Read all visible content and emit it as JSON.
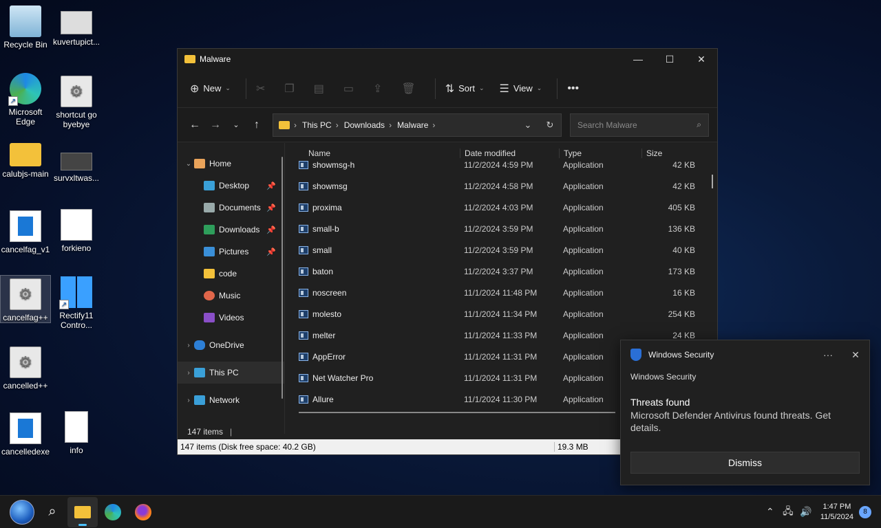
{
  "desktop": {
    "icons": [
      {
        "label": "Recycle Bin"
      },
      {
        "label": "kuvertupict..."
      },
      {
        "label": "Microsoft Edge"
      },
      {
        "label": "shortcut go byebye"
      },
      {
        "label": "calubjs-main"
      },
      {
        "label": "survxltwas..."
      },
      {
        "label": "cancelfag_v1"
      },
      {
        "label": "forkieno"
      },
      {
        "label": "cancelfag++"
      },
      {
        "label": "Rectify11 Contro..."
      },
      {
        "label": "cancelled++"
      },
      {
        "label": "cancelledexe"
      },
      {
        "label": "info"
      }
    ]
  },
  "explorer": {
    "title": "Malware",
    "toolbar": {
      "new_label": "New",
      "sort_label": "Sort",
      "view_label": "View"
    },
    "address": {
      "crumbs": [
        "This PC",
        "Downloads",
        "Malware"
      ]
    },
    "search": {
      "placeholder": "Search Malware"
    },
    "sidebar": {
      "items": [
        {
          "label": "Home"
        },
        {
          "label": "Desktop"
        },
        {
          "label": "Documents"
        },
        {
          "label": "Downloads"
        },
        {
          "label": "Pictures"
        },
        {
          "label": "code"
        },
        {
          "label": "Music"
        },
        {
          "label": "Videos"
        },
        {
          "label": "OneDrive"
        },
        {
          "label": "This PC"
        },
        {
          "label": "Network"
        }
      ]
    },
    "columns": {
      "name": "Name",
      "date": "Date modified",
      "type": "Type",
      "size": "Size"
    },
    "files": [
      {
        "name": "showmsg-h",
        "date": "11/2/2024 4:59 PM",
        "type": "Application",
        "size": "42 KB"
      },
      {
        "name": "showmsg",
        "date": "11/2/2024 4:58 PM",
        "type": "Application",
        "size": "42 KB"
      },
      {
        "name": "proxima",
        "date": "11/2/2024 4:03 PM",
        "type": "Application",
        "size": "405 KB"
      },
      {
        "name": "small-b",
        "date": "11/2/2024 3:59 PM",
        "type": "Application",
        "size": "136 KB"
      },
      {
        "name": "small",
        "date": "11/2/2024 3:59 PM",
        "type": "Application",
        "size": "40 KB"
      },
      {
        "name": "baton",
        "date": "11/2/2024 3:37 PM",
        "type": "Application",
        "size": "173 KB"
      },
      {
        "name": "noscreen",
        "date": "11/1/2024 11:48 PM",
        "type": "Application",
        "size": "16 KB"
      },
      {
        "name": "molesto",
        "date": "11/1/2024 11:34 PM",
        "type": "Application",
        "size": "254 KB"
      },
      {
        "name": "melter",
        "date": "11/1/2024 11:33 PM",
        "type": "Application",
        "size": "24 KB"
      },
      {
        "name": "AppError",
        "date": "11/1/2024 11:31 PM",
        "type": "Application",
        "size": ""
      },
      {
        "name": "Net Watcher Pro",
        "date": "11/1/2024 11:31 PM",
        "type": "Application",
        "size": ""
      },
      {
        "name": "Allure",
        "date": "11/1/2024 11:30 PM",
        "type": "Application",
        "size": ""
      }
    ],
    "status": {
      "items": "147 items",
      "detail": "147 items (Disk free space: 40.2 GB)",
      "size": "19.3 MB"
    }
  },
  "toast": {
    "header": "Windows Security",
    "app": "Windows Security",
    "title": "Threats found",
    "message": "Microsoft Defender Antivirus found threats. Get details.",
    "dismiss_label": "Dismiss"
  },
  "taskbar": {
    "time": "1:47 PM",
    "date": "11/5/2024",
    "notification_count": "8"
  }
}
